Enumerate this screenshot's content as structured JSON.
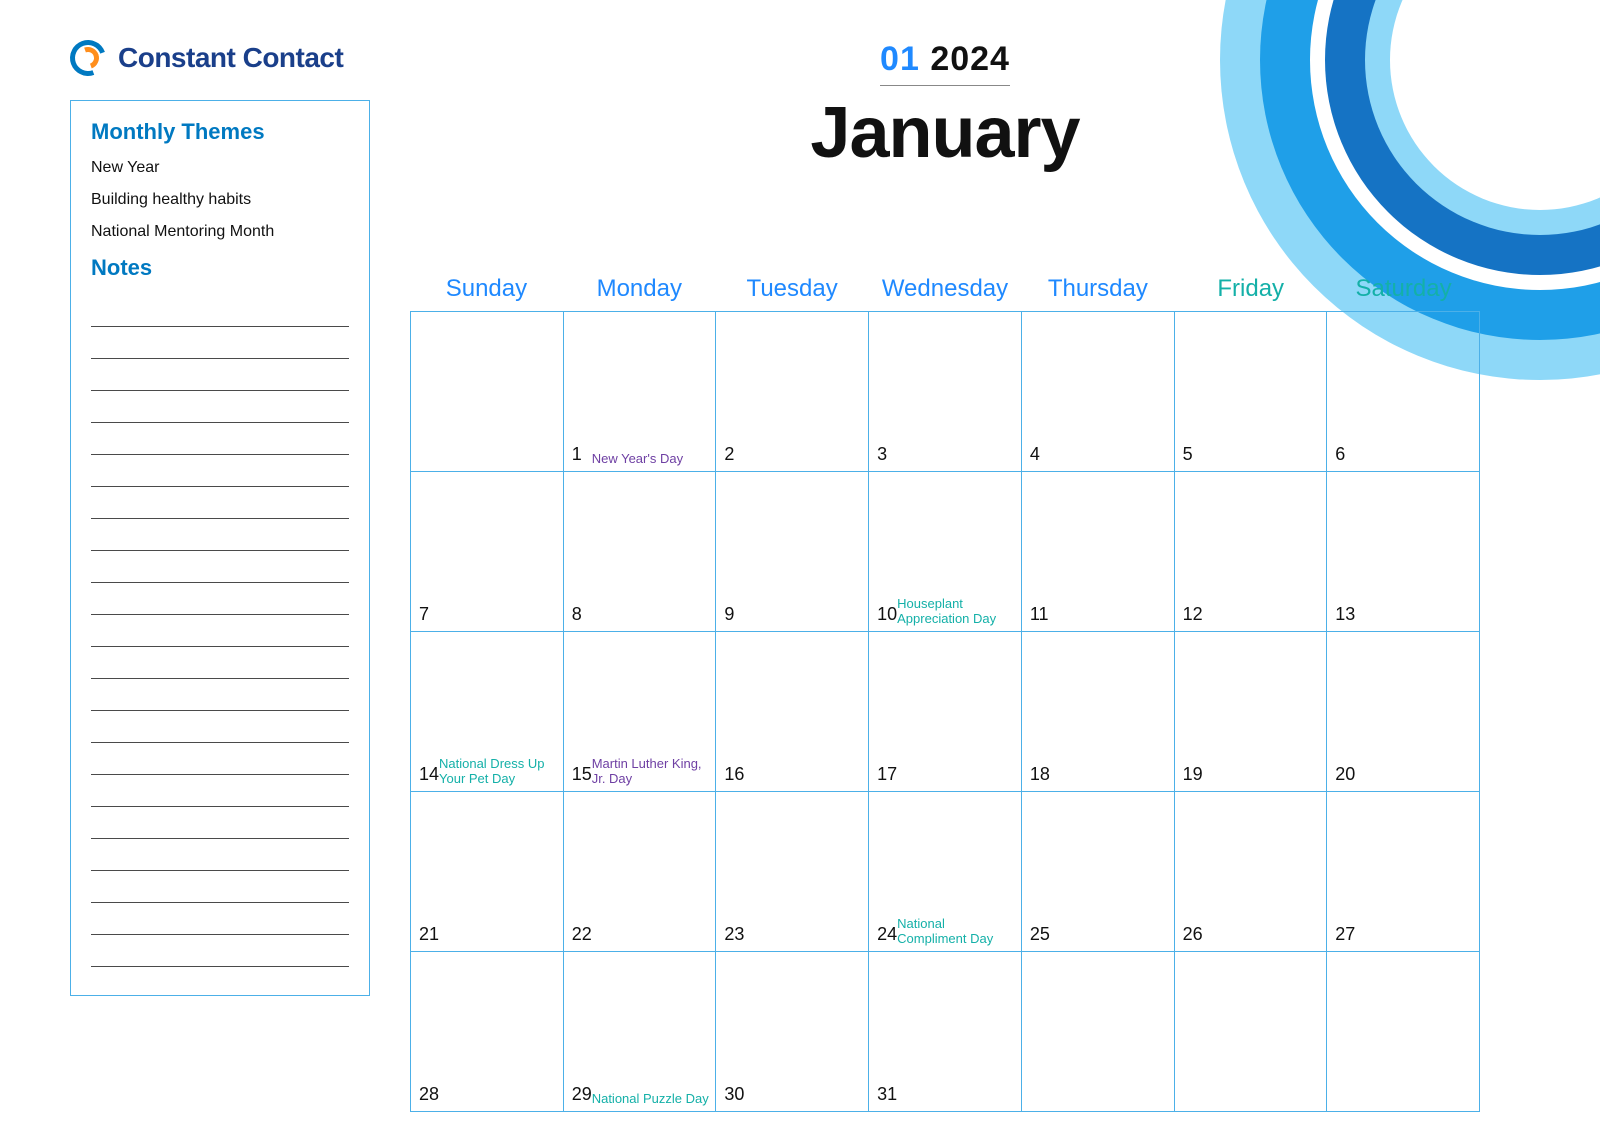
{
  "brand": {
    "name": "Constant Contact"
  },
  "header": {
    "month_number": "01",
    "year": "2024",
    "month_name": "January"
  },
  "sidebar": {
    "themes_title": "Monthly Themes",
    "themes": [
      "New Year",
      "Building healthy habits",
      "National Mentoring Month"
    ],
    "notes_title": "Notes",
    "note_line_count": 21
  },
  "days_of_week": [
    {
      "label": "Sunday",
      "color": "blue"
    },
    {
      "label": "Monday",
      "color": "blue"
    },
    {
      "label": "Tuesday",
      "color": "blue"
    },
    {
      "label": "Wednesday",
      "color": "blue"
    },
    {
      "label": "Thursday",
      "color": "blue"
    },
    {
      "label": "Friday",
      "color": "teal"
    },
    {
      "label": "Saturday",
      "color": "teal"
    }
  ],
  "calendar": {
    "leading_blanks": 1,
    "trailing_blanks": 3,
    "days": [
      {
        "n": 1,
        "event": {
          "text": "New Year's Day",
          "color": "purple"
        }
      },
      {
        "n": 2
      },
      {
        "n": 3
      },
      {
        "n": 4
      },
      {
        "n": 5
      },
      {
        "n": 6
      },
      {
        "n": 7
      },
      {
        "n": 8
      },
      {
        "n": 9
      },
      {
        "n": 10,
        "event": {
          "text": "Houseplant Appreciation Day",
          "color": "teal"
        }
      },
      {
        "n": 11
      },
      {
        "n": 12
      },
      {
        "n": 13
      },
      {
        "n": 14,
        "event": {
          "text": "National Dress Up Your Pet Day",
          "color": "teal"
        }
      },
      {
        "n": 15,
        "event": {
          "text": "Martin Luther King, Jr. Day",
          "color": "purple"
        }
      },
      {
        "n": 16
      },
      {
        "n": 17
      },
      {
        "n": 18
      },
      {
        "n": 19
      },
      {
        "n": 20
      },
      {
        "n": 21
      },
      {
        "n": 22
      },
      {
        "n": 23
      },
      {
        "n": 24,
        "event": {
          "text": "National Compliment Day",
          "color": "teal"
        }
      },
      {
        "n": 25
      },
      {
        "n": 26
      },
      {
        "n": 27
      },
      {
        "n": 28
      },
      {
        "n": 29,
        "event": {
          "text": "National Puzzle Day",
          "color": "teal"
        }
      },
      {
        "n": 30
      },
      {
        "n": 31
      }
    ]
  }
}
